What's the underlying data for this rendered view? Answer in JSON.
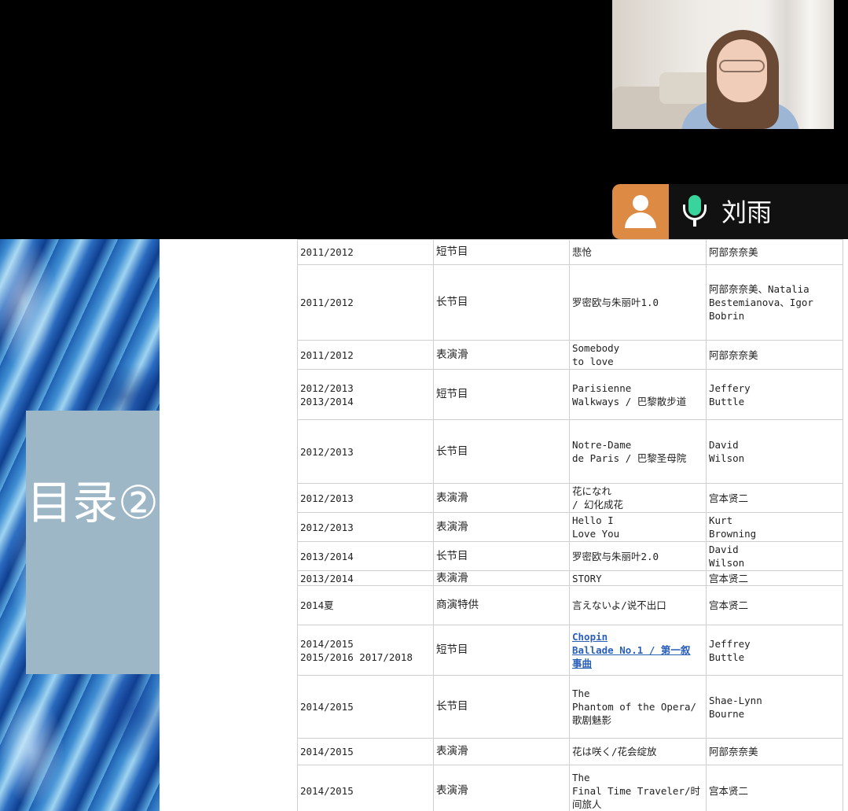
{
  "meeting": {
    "participant_name": "刘雨"
  },
  "slide": {
    "toc_title": "目录②",
    "rows": [
      {
        "season": "2011/2012",
        "category": "短节目",
        "program": "悲怆",
        "choreographer": "阿部奈奈美",
        "h": 32
      },
      {
        "season": "2011/2012",
        "category": "长节目",
        "program": "罗密欧与朱丽叶1.0",
        "choreographer": "阿部奈奈美、Natalia\nBestemianova、Igor\nBobrin",
        "h": 96
      },
      {
        "season": "2011/2012",
        "category": "表演滑",
        "program": "Somebody\nto love",
        "choreographer": "阿部奈奈美",
        "h": 37
      },
      {
        "season": "2012/2013\n2013/2014",
        "category": "短节目",
        "program": "Parisienne\nWalkways / 巴黎散步道",
        "choreographer": "Jeffery\nButtle",
        "h": 64
      },
      {
        "season": "2012/2013",
        "category": "长节目",
        "program": "Notre-Dame\nde Paris / 巴黎圣母院",
        "choreographer": "David\nWilson",
        "h": 81
      },
      {
        "season": "2012/2013",
        "category": "表演滑",
        "program": "花になれ\n/ 幻化成花",
        "choreographer": "宫本贤二",
        "h": 37
      },
      {
        "season": "2012/2013",
        "category": "表演滑",
        "program": "Hello I\nLove You",
        "choreographer": "Kurt\nBrowning",
        "h": 37
      },
      {
        "season": "2013/2014",
        "category": "长节目",
        "program": "罗密欧与朱丽叶2.0",
        "choreographer": "David\nWilson",
        "h": 37
      },
      {
        "season": "2013/2014",
        "category": "表演滑",
        "program": "STORY",
        "choreographer": "宫本贤二",
        "h": 19
      },
      {
        "season": "2014夏",
        "category": "商演特供",
        "program": "言えないよ/说不出口",
        "choreographer": "宫本贤二",
        "h": 50
      },
      {
        "season": "2014/2015\n2015/2016 2017/2018",
        "category": "短节目",
        "program": "Chopin\nBallade No.1 / 第一叙\n事曲",
        "choreographer": "Jeffrey\nButtle",
        "h": 64,
        "link": true
      },
      {
        "season": "2014/2015",
        "category": "长节目",
        "program": "The\nPhantom of the Opera/\n歌剧魅影",
        "choreographer": "Shae-Lynn\nBourne",
        "h": 80
      },
      {
        "season": "2014/2015",
        "category": "表演滑",
        "program": "花は咲く/花会绽放",
        "choreographer": "阿部奈奈美",
        "h": 34
      },
      {
        "season": "2014/2015",
        "category": "表演滑",
        "program": "The\nFinal Time Traveler/时\n间旅人",
        "choreographer": "宫本贤二",
        "h": 66
      }
    ]
  }
}
